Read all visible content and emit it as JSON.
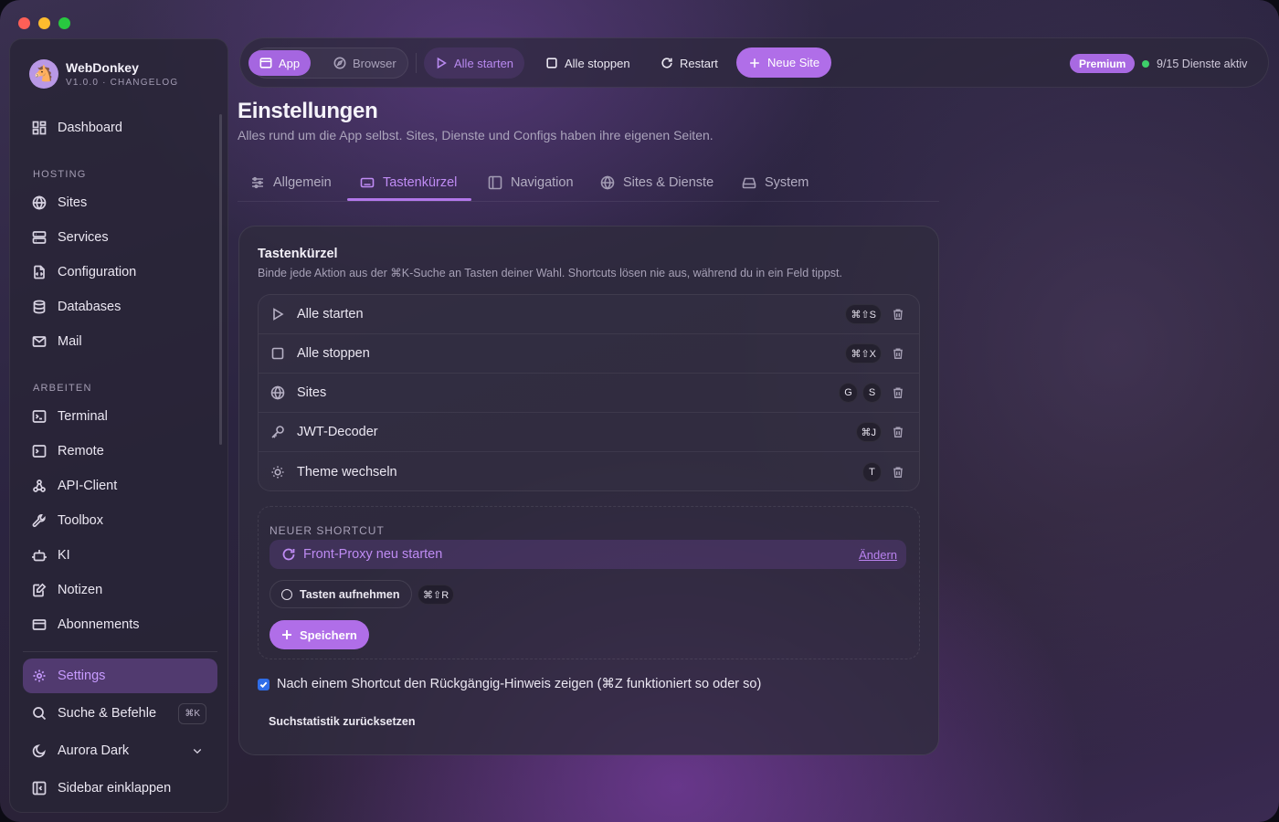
{
  "app": {
    "name": "WebDonkey",
    "version_line": "V1.0.0 · CHANGELOG"
  },
  "sidebar": {
    "top": [
      {
        "label": "Dashboard",
        "icon": "dashboard-icon"
      }
    ],
    "sections": [
      {
        "title": "HOSTING",
        "items": [
          {
            "label": "Sites",
            "icon": "globe-icon"
          },
          {
            "label": "Services",
            "icon": "server-icon"
          },
          {
            "label": "Configuration",
            "icon": "file-code-icon"
          },
          {
            "label": "Databases",
            "icon": "database-icon"
          },
          {
            "label": "Mail",
            "icon": "mail-icon"
          }
        ]
      },
      {
        "title": "ARBEITEN",
        "items": [
          {
            "label": "Terminal",
            "icon": "terminal-icon"
          },
          {
            "label": "Remote",
            "icon": "remote-terminal-icon"
          },
          {
            "label": "API-Client",
            "icon": "api-icon"
          },
          {
            "label": "Toolbox",
            "icon": "wrench-icon"
          },
          {
            "label": "KI",
            "icon": "robot-icon"
          },
          {
            "label": "Notizen",
            "icon": "note-icon"
          },
          {
            "label": "Abonnements",
            "icon": "card-icon"
          }
        ]
      }
    ],
    "bottom": {
      "settings": "Settings",
      "search": "Suche & Befehle",
      "search_kbd": "⌘K",
      "theme": "Aurora Dark",
      "collapse": "Sidebar einklappen"
    }
  },
  "topbar": {
    "app_tab": "App",
    "browser_tab": "Browser",
    "start_all": "Alle starten",
    "stop_all": "Alle stoppen",
    "restart": "Restart",
    "new_site": "Neue Site",
    "premium": "Premium",
    "status": "9/15 Dienste aktiv"
  },
  "page": {
    "title": "Einstellungen",
    "subtitle": "Alles rund um die App selbst. Sites, Dienste und Configs haben ihre eigenen Seiten.",
    "tabs": [
      "Allgemein",
      "Tastenkürzel",
      "Navigation",
      "Sites & Dienste",
      "System"
    ],
    "active_tab": "Tastenkürzel"
  },
  "shortcuts": {
    "title": "Tastenkürzel",
    "description": "Binde jede Aktion aus der ⌘K-Suche an Tasten deiner Wahl. Shortcuts lösen nie aus, während du in ein Feld tippst.",
    "rows": [
      {
        "label": "Alle starten",
        "icon": "play-icon",
        "keys": [
          "⌘⇧S"
        ]
      },
      {
        "label": "Alle stoppen",
        "icon": "stop-icon",
        "keys": [
          "⌘⇧X"
        ]
      },
      {
        "label": "Sites",
        "icon": "globe-icon",
        "keys": [
          "G",
          "S"
        ]
      },
      {
        "label": "JWT-Decoder",
        "icon": "key-icon",
        "keys": [
          "⌘J"
        ]
      },
      {
        "label": "Theme wechseln",
        "icon": "sun-icon",
        "keys": [
          "T"
        ]
      }
    ],
    "new": {
      "label": "NEUER SHORTCUT",
      "action": "Front-Proxy neu starten",
      "change": "Ändern",
      "record": "Tasten aufnehmen",
      "recorded_keys": "⌘⇧R",
      "save": "Speichern"
    },
    "undo_hint_checkbox": "Nach einem Shortcut den Rückgängig-Hinweis zeigen (⌘Z funktioniert so oder so)",
    "undo_hint_checked": true,
    "reset_stats": "Suchstatistik zurücksetzen"
  },
  "colors": {
    "accent": "#b06ee8",
    "accent_text": "#c08cf5",
    "status_green": "#3ecf6a",
    "checkbox_blue": "#2f6de8"
  }
}
